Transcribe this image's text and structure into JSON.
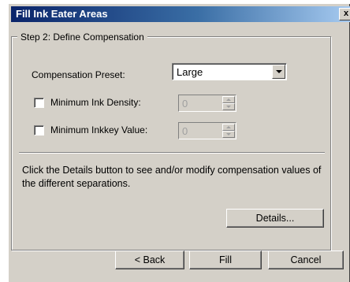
{
  "window": {
    "title": "Fill Ink Eater Areas",
    "close_label": "x"
  },
  "step": {
    "legend": "Step 2: Define Compensation"
  },
  "compensation_preset": {
    "label": "Compensation Preset:",
    "value": "Large"
  },
  "min_ink_density": {
    "label": "Minimum Ink Density:",
    "value": "0",
    "checked": false,
    "enabled": false
  },
  "min_inkkey_value": {
    "label": "Minimum Inkkey Value:",
    "value": "0",
    "checked": false,
    "enabled": false
  },
  "info_text": "Click the Details button to see and/or modify compensation values of the different separations.",
  "buttons": {
    "details": "Details...",
    "back": "< Back",
    "fill": "Fill",
    "cancel": "Cancel"
  }
}
